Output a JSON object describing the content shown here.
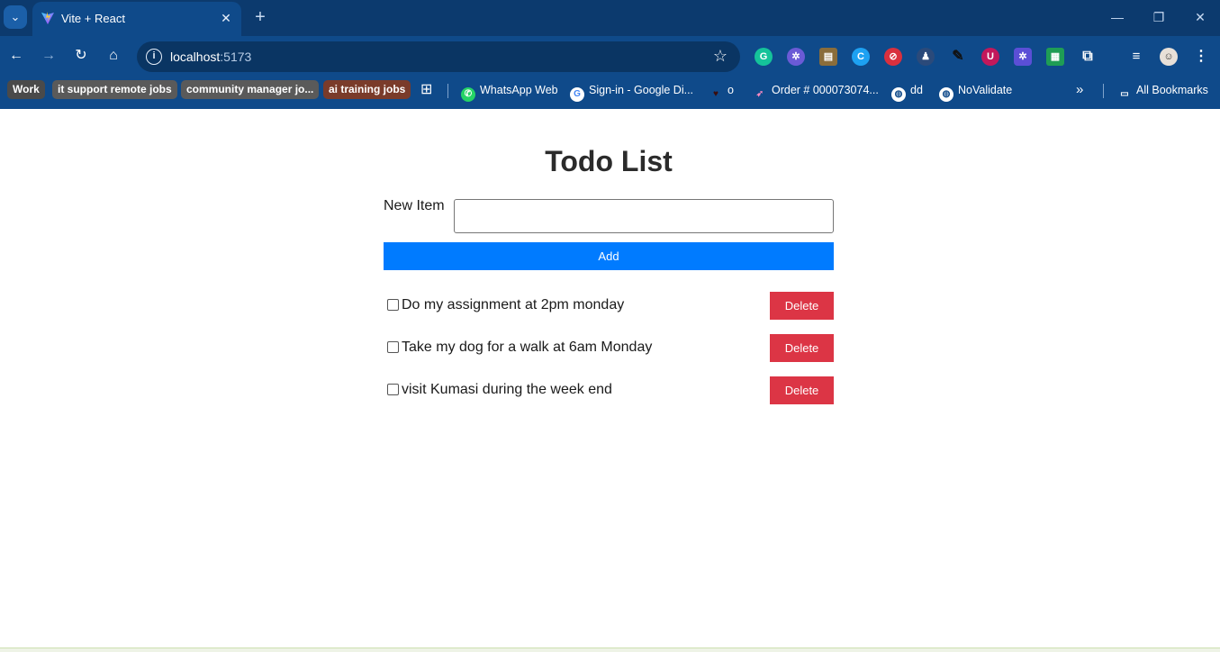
{
  "browser": {
    "tab_title": "Vite + React",
    "url_host": "localhost",
    "url_port": ":5173",
    "bookmarks_bar": {
      "chips": [
        {
          "label": "Work",
          "color": "#4a4a4a"
        },
        {
          "label": "it support remote jobs",
          "color": "#5a5a5a"
        },
        {
          "label": "community manager jo...",
          "color": "#5a5a5a"
        },
        {
          "label": "ai training jobs",
          "color": "#7a3b2a"
        }
      ],
      "links": [
        {
          "label": "WhatsApp Web",
          "icon": "whatsapp-icon"
        },
        {
          "label": "Sign-in - Google Di...",
          "icon": "google-icon"
        },
        {
          "label": "o",
          "icon": "heart-icon"
        },
        {
          "label": "Order # 000073074...",
          "icon": "runner-icon"
        },
        {
          "label": "dd",
          "icon": "globe-icon"
        },
        {
          "label": "NoValidate",
          "icon": "globe-icon"
        }
      ],
      "all_bookmarks": "All Bookmarks"
    }
  },
  "app": {
    "title": "Todo List",
    "new_item_label": "New Item",
    "new_item_value": "",
    "add_label": "Add",
    "todos": [
      {
        "text": "Do my assignment at 2pm monday",
        "done": false,
        "delete_label": "Delete"
      },
      {
        "text": "Take my dog for a walk at 6am Monday",
        "done": false,
        "delete_label": "Delete"
      },
      {
        "text": "visit Kumasi during the week end",
        "done": false,
        "delete_label": "Delete"
      }
    ]
  },
  "colors": {
    "add_button": "#007bff",
    "delete_button": "#dc3545",
    "chrome_toolbar": "#0f4a8a",
    "chrome_tabstrip": "#0c3a6e"
  }
}
